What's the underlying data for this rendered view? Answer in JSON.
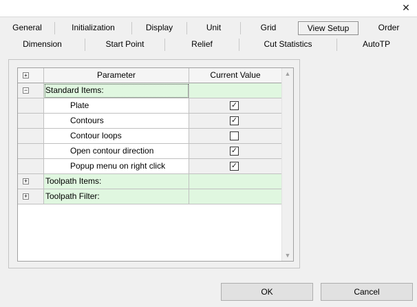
{
  "window": {
    "close_glyph": "✕"
  },
  "tabs": {
    "row1": [
      {
        "label": "General"
      },
      {
        "label": "Initialization"
      },
      {
        "label": "Display"
      },
      {
        "label": "Unit"
      },
      {
        "label": "Grid"
      },
      {
        "label": "View Setup"
      },
      {
        "label": "Order"
      }
    ],
    "row2": [
      {
        "label": "Dimension"
      },
      {
        "label": "Start Point"
      },
      {
        "label": "Relief"
      },
      {
        "label": "Cut Statistics"
      },
      {
        "label": "AutoTP"
      }
    ],
    "active_tab": "View Setup"
  },
  "grid": {
    "header": {
      "expand_glyph": "⊞",
      "parameter": "Parameter",
      "current_value": "Current Value"
    },
    "rows": [
      {
        "type": "group",
        "expander": "−",
        "label": "Standard Items:"
      },
      {
        "type": "item",
        "label": "Plate",
        "checked": true
      },
      {
        "type": "item",
        "label": "Contours",
        "checked": true
      },
      {
        "type": "item",
        "label": "Contour loops",
        "checked": false
      },
      {
        "type": "item",
        "label": "Open contour direction",
        "checked": true
      },
      {
        "type": "item",
        "label": "Popup menu on right click",
        "checked": true
      },
      {
        "type": "group",
        "expander": "+",
        "label": "Toolpath Items:"
      },
      {
        "type": "group",
        "expander": "+",
        "label": "Toolpath Filter:"
      }
    ],
    "scroll_up_glyph": "▲",
    "scroll_down_glyph": "▼"
  },
  "buttons": {
    "ok": "OK",
    "cancel": "Cancel"
  },
  "colors": {
    "group_row": "#e0f7e0",
    "value_cell": "#f0f0f0"
  }
}
